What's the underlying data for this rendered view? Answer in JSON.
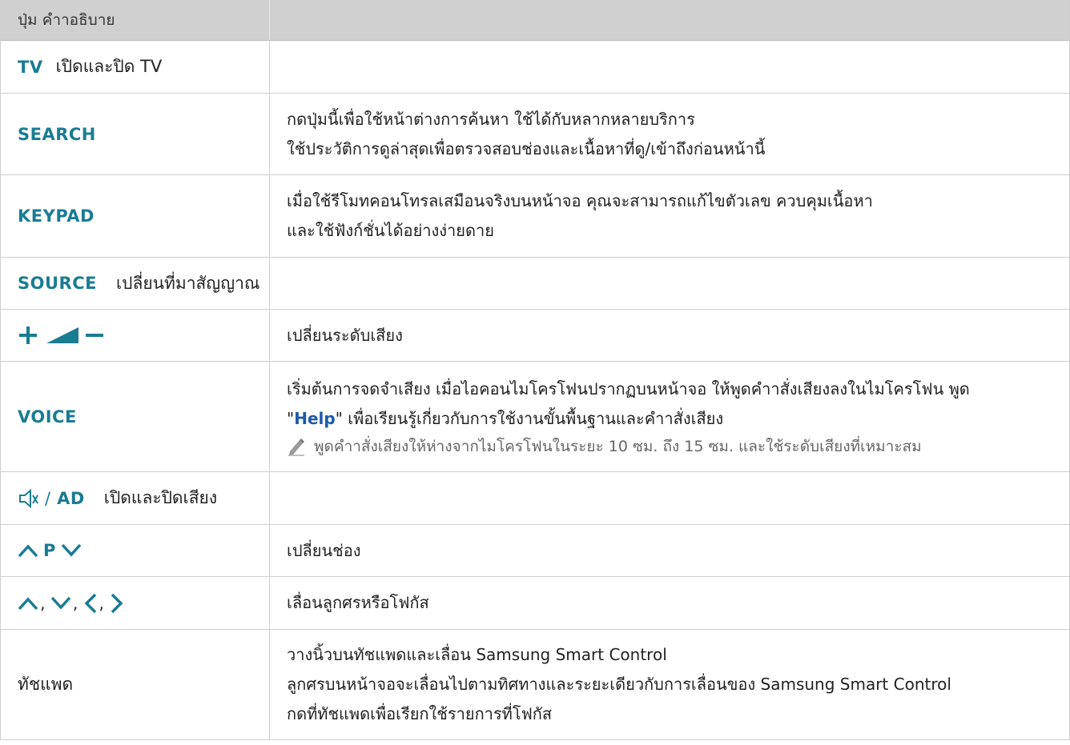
{
  "header": {
    "col1": "ปุ่ม คำาอธิบาย",
    "col2": ""
  },
  "rows": [
    {
      "key": "TV",
      "inline": "เปิดและปิด TV"
    },
    {
      "key": "SEARCH",
      "lines": [
        "กดปุ่มนี้เพื่อใช้หน้าต่างการค้นหา ใช้ได้กับหลากหลายบริการ",
        "ใช้ประวัติการดูล่าสุดเพื่อตรวจสอบช่องและเนื้อหาที่ดู/เข้าถึงก่อนหน้านี้"
      ]
    },
    {
      "key": "KEYPAD",
      "lines": [
        "เมื่อใช้รีโมทคอนโทรลเสมือนจริงบนหน้าจอ คุณจะสามารถแก้ไขตัวเลข ควบคุมเนื้อหา",
        "และใช้ฟังก์ชั่นได้อย่างง่ายดาย"
      ]
    },
    {
      "key": "SOURCE",
      "inline": "เปลี่ยนที่มาสัญญาณ"
    },
    {
      "key_icons": [
        "plus-icon",
        "volume-ramp-icon",
        "minus-icon"
      ],
      "lines": [
        "เปลี่ยนระดับเสียง"
      ]
    },
    {
      "key": "VOICE",
      "line1": "เริ่มต้นการจดจำเสียง เมื่อไอคอนไมโครโฟนปรากฏบนหน้าจอ ให้พูดคำาสั่งเสียงลงในไมโครโฟน พูด",
      "line2_pre": "\"",
      "line2_help": "Help",
      "line2_post": "\" เพื่อเรียนรู้เกี่ยวกับการใช้งานขั้นพื้นฐานและคำาสั่งเสียง",
      "note": "พูดคำาสั่งเสียงให้ห่างจากไมโครโฟนในระยะ 10 ซม. ถึง 15 ซม. และใช้ระดับเสียงที่เหมาะสม"
    },
    {
      "key_icon": "mute-icon",
      "key_sep": "/",
      "key": "AD",
      "inline": "เปิดและปิดเสียง"
    },
    {
      "key_icons": [
        "chevron-up-icon",
        "chevron-down-icon"
      ],
      "key": "P",
      "lines": [
        "เปลี่ยนช่อง"
      ]
    },
    {
      "key_icons": [
        "chevron-up-icon",
        "chevron-down-icon",
        "chevron-left-icon",
        "chevron-right-icon"
      ],
      "key_sep": ",",
      "lines": [
        "เลื่อนลูกศรหรือโฟกัส"
      ]
    },
    {
      "key_text": "ทัชแพด",
      "lines": [
        "วางนิ้วบนทัชแพดและเลื่อน Samsung Smart Control",
        "ลูกศรบนหน้าจอจะเลื่อนไปตามทิศทางและระยะเดียวกับการเลื่อนของ Samsung Smart Control",
        "กดที่ทัชแพดเพื่อเรียกใช้รายการที่โฟกัส"
      ]
    }
  ],
  "colors": {
    "key": "#1a7c93",
    "help": "#1a5aa8",
    "header_bg": "#d0d0d0"
  }
}
